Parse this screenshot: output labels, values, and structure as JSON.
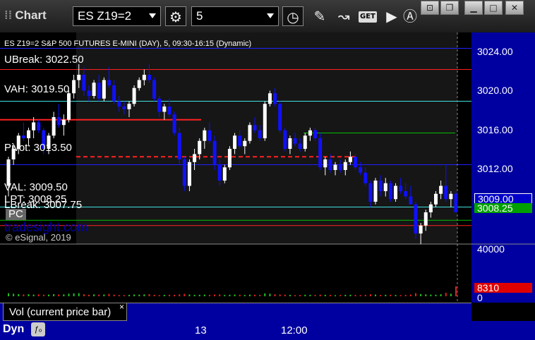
{
  "toolbar": {
    "app_title": "Chart",
    "symbol": "ES Z19=2",
    "interval": "5",
    "get_label": "GET"
  },
  "header": {
    "description": "ES Z19=2 S&P 500 FUTURES E-MINI (DAY), 5, 09:30-16:15 (Dynamic)"
  },
  "levels": {
    "ubreak": "UBreak: 3022.50",
    "vah": "VAH: 3019.50",
    "pivot": "Pivot: 3013.50",
    "val": "VAL: 3009.50",
    "lpt": "LPT: 3008.25",
    "lbreak": "LBreak: 3007.75",
    "pc": "PC"
  },
  "brand": "tradesight.com",
  "copyright": "© eSignal, 2019",
  "price_axis": {
    "ticks": [
      "3024.00",
      "3020.00",
      "3016.00",
      "3012.00"
    ],
    "last_price": "3009.00",
    "lpt_price": "3008.25"
  },
  "volume_axis": {
    "ticks": [
      "40000",
      "0"
    ],
    "current": "8310"
  },
  "volume_panel": {
    "label": "Vol (current price bar)",
    "close": "×"
  },
  "time_axis": {
    "labels": [
      "13",
      "12:00"
    ]
  },
  "footer": {
    "dyn": "Dyn"
  },
  "colors": {
    "up_candle": "#ffffff",
    "down_candle": "#1010ff",
    "resistance": "#ff2020",
    "value_area": "#40e0e0",
    "pivot": "#2020ff",
    "support_green": "#00c000"
  },
  "chart_data": {
    "type": "candlestick",
    "ylim": [
      3006,
      3026
    ],
    "levels": {
      "ubreak": 3022.5,
      "vah": 3019.5,
      "pivot": 3013.5,
      "val": 3009.5,
      "lpt": 3008.25,
      "lbreak": 3007.75
    },
    "candles": [
      [
        3011.5,
        3014.25,
        3010.5,
        3014.0
      ],
      [
        3014.0,
        3015.5,
        3013.5,
        3015.0
      ],
      [
        3015.0,
        3016.5,
        3014.5,
        3016.25
      ],
      [
        3016.25,
        3017.5,
        3015.75,
        3016.0
      ],
      [
        3016.0,
        3017.0,
        3015.25,
        3016.75
      ],
      [
        3016.75,
        3018.0,
        3016.0,
        3017.5
      ],
      [
        3017.5,
        3017.75,
        3016.5,
        3016.75
      ],
      [
        3016.75,
        3017.0,
        3014.5,
        3015.0
      ],
      [
        3015.0,
        3016.5,
        3014.5,
        3016.25
      ],
      [
        3016.25,
        3018.5,
        3016.0,
        3018.0
      ],
      [
        3018.0,
        3019.25,
        3017.0,
        3017.25
      ],
      [
        3017.25,
        3018.25,
        3016.25,
        3017.75
      ],
      [
        3017.75,
        3020.5,
        3017.5,
        3020.25
      ],
      [
        3020.25,
        3022.0,
        3019.75,
        3021.5
      ],
      [
        3021.5,
        3023.0,
        3020.75,
        3022.0
      ],
      [
        3022.0,
        3022.75,
        3020.0,
        3020.5
      ],
      [
        3020.5,
        3021.0,
        3019.5,
        3020.0
      ],
      [
        3020.0,
        3021.5,
        3019.75,
        3021.25
      ],
      [
        3021.25,
        3022.0,
        3019.5,
        3019.75
      ],
      [
        3019.75,
        3021.75,
        3019.5,
        3021.5
      ],
      [
        3021.5,
        3022.75,
        3020.75,
        3021.0
      ],
      [
        3021.0,
        3021.5,
        3019.25,
        3019.5
      ],
      [
        3019.5,
        3020.0,
        3018.5,
        3019.0
      ],
      [
        3019.0,
        3019.5,
        3018.25,
        3018.75
      ],
      [
        3018.75,
        3019.5,
        3018.0,
        3019.25
      ],
      [
        3019.25,
        3021.0,
        3019.0,
        3020.75
      ],
      [
        3020.75,
        3021.75,
        3020.5,
        3021.5
      ],
      [
        3021.5,
        3022.5,
        3021.0,
        3022.0
      ],
      [
        3022.0,
        3023.0,
        3021.25,
        3021.5
      ],
      [
        3021.5,
        3021.75,
        3019.5,
        3019.75
      ],
      [
        3019.75,
        3020.0,
        3018.0,
        3018.5
      ],
      [
        3018.5,
        3019.25,
        3017.75,
        3019.0
      ],
      [
        3019.0,
        3019.75,
        3018.0,
        3018.25
      ],
      [
        3018.25,
        3018.5,
        3016.25,
        3016.5
      ],
      [
        3016.5,
        3017.0,
        3013.5,
        3014.0
      ],
      [
        3014.0,
        3014.25,
        3011.0,
        3011.5
      ],
      [
        3011.5,
        3014.0,
        3011.0,
        3013.75
      ],
      [
        3013.75,
        3015.0,
        3013.0,
        3014.5
      ],
      [
        3014.5,
        3016.0,
        3014.0,
        3015.75
      ],
      [
        3015.75,
        3017.0,
        3015.0,
        3016.75
      ],
      [
        3016.75,
        3017.5,
        3015.5,
        3015.75
      ],
      [
        3015.75,
        3016.25,
        3013.0,
        3013.5
      ],
      [
        3013.5,
        3014.0,
        3011.5,
        3012.0
      ],
      [
        3012.0,
        3013.5,
        3011.75,
        3013.25
      ],
      [
        3013.25,
        3015.25,
        3013.0,
        3015.0
      ],
      [
        3015.0,
        3016.5,
        3014.5,
        3016.25
      ],
      [
        3016.25,
        3016.75,
        3015.0,
        3015.25
      ],
      [
        3015.25,
        3016.0,
        3014.5,
        3015.75
      ],
      [
        3015.75,
        3017.5,
        3015.5,
        3017.25
      ],
      [
        3017.25,
        3018.0,
        3016.5,
        3016.75
      ],
      [
        3016.75,
        3017.25,
        3015.75,
        3016.0
      ],
      [
        3016.0,
        3019.5,
        3015.75,
        3019.25
      ],
      [
        3019.25,
        3020.5,
        3019.0,
        3020.25
      ],
      [
        3020.25,
        3020.75,
        3019.0,
        3019.25
      ],
      [
        3019.25,
        3019.5,
        3016.5,
        3016.75
      ],
      [
        3016.75,
        3017.0,
        3014.75,
        3015.0
      ],
      [
        3015.0,
        3016.25,
        3014.5,
        3016.0
      ],
      [
        3016.0,
        3016.5,
        3015.25,
        3015.5
      ],
      [
        3015.5,
        3016.0,
        3014.75,
        3015.0
      ],
      [
        3015.0,
        3016.5,
        3014.75,
        3016.25
      ],
      [
        3016.25,
        3017.0,
        3015.75,
        3016.75
      ],
      [
        3016.75,
        3017.0,
        3015.75,
        3016.0
      ],
      [
        3016.0,
        3016.5,
        3013.0,
        3013.25
      ],
      [
        3013.25,
        3014.25,
        3012.5,
        3014.0
      ],
      [
        3014.0,
        3014.5,
        3012.75,
        3013.0
      ],
      [
        3013.0,
        3013.75,
        3012.5,
        3013.5
      ],
      [
        3013.5,
        3014.0,
        3012.75,
        3013.0
      ],
      [
        3013.0,
        3014.0,
        3012.5,
        3013.75
      ],
      [
        3013.75,
        3014.75,
        3013.5,
        3014.25
      ],
      [
        3014.25,
        3014.5,
        3013.0,
        3013.25
      ],
      [
        3013.25,
        3013.75,
        3012.5,
        3012.75
      ],
      [
        3012.75,
        3013.25,
        3011.5,
        3011.75
      ],
      [
        3011.75,
        3012.0,
        3009.5,
        3010.0
      ],
      [
        3010.0,
        3012.25,
        3009.75,
        3012.0
      ],
      [
        3012.0,
        3012.5,
        3010.5,
        3011.0
      ],
      [
        3011.0,
        3012.25,
        3010.5,
        3011.75
      ],
      [
        3011.75,
        3012.0,
        3010.0,
        3010.25
      ],
      [
        3010.25,
        3011.75,
        3010.0,
        3011.5
      ],
      [
        3011.5,
        3012.25,
        3010.75,
        3011.0
      ],
      [
        3011.0,
        3011.75,
        3010.25,
        3010.5
      ],
      [
        3010.5,
        3011.5,
        3009.75,
        3009.75
      ],
      [
        3009.75,
        3010.0,
        3006.5,
        3007.0
      ],
      [
        3007.0,
        3008.0,
        3006.0,
        3007.75
      ],
      [
        3007.75,
        3009.25,
        3007.25,
        3009.0
      ],
      [
        3009.0,
        3010.0,
        3008.5,
        3009.75
      ],
      [
        3009.75,
        3011.0,
        3009.5,
        3010.75
      ],
      [
        3010.75,
        3012.0,
        3010.25,
        3011.5
      ],
      [
        3011.5,
        3013.5,
        3010.0,
        3010.25
      ],
      [
        3010.25,
        3011.0,
        3009.5,
        3010.75
      ],
      [
        3010.75,
        3011.0,
        3009.25,
        3009.0
      ]
    ],
    "volume": [
      2500,
      2100,
      1800,
      1500,
      1700,
      1400,
      1600,
      1300,
      1400,
      1800,
      1500,
      1600,
      2200,
      2400,
      2600,
      1700,
      1300,
      1600,
      1400,
      1500,
      2000,
      1300,
      1100,
      1000,
      1200,
      1500,
      1400,
      1600,
      1800,
      1200,
      1000,
      1200,
      1300,
      1200,
      1600,
      2000,
      1500,
      1200,
      1300,
      1400,
      1200,
      1500,
      1600,
      1100,
      1300,
      1500,
      1300,
      1100,
      1400,
      1300,
      1200,
      2400,
      2100,
      1700,
      1500,
      1300,
      1200,
      1000,
      1100,
      1300,
      1200,
      1100,
      1400,
      1200,
      1100,
      900,
      1000,
      1200,
      1300,
      1100,
      1000,
      1200,
      1700,
      1400,
      1100,
      1200,
      1300,
      1100,
      1000,
      1100,
      1500,
      2600,
      1900,
      1600,
      1400,
      1300,
      1700,
      2900,
      2100,
      8310
    ]
  }
}
